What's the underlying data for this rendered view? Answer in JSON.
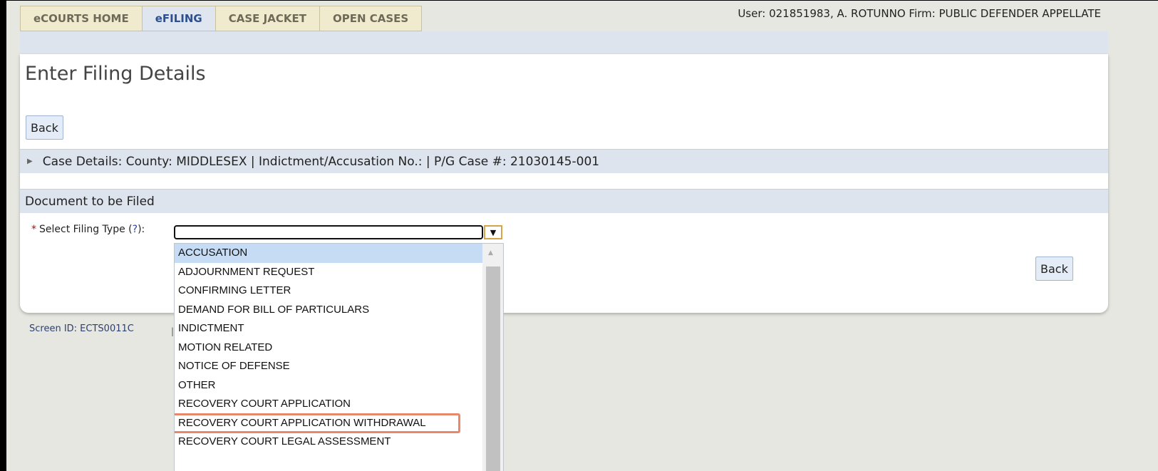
{
  "tabs": [
    {
      "label": "eCOURTS HOME",
      "active": false
    },
    {
      "label": "eFILING",
      "active": true
    },
    {
      "label": "CASE JACKET",
      "active": false
    },
    {
      "label": "OPEN CASES",
      "active": false
    }
  ],
  "header": {
    "user_info": "User: 021851983, A. ROTUNNO  Firm: PUBLIC DEFENDER APPELLATE"
  },
  "page": {
    "title": "Enter Filing Details",
    "back_label": "Back",
    "back_label_bottom": "Back"
  },
  "case_details": {
    "text": "Case Details: County: MIDDLESEX | Indictment/Accusation No.:  | P/G Case #: 21030145-001"
  },
  "document_section": {
    "title": "Document to be Filed",
    "required_marker": "*",
    "field_label": "Select Filing Type (",
    "help_link": "?",
    "field_label_end": "):",
    "selected_value": ""
  },
  "dropdown": {
    "options": [
      "ACCUSATION",
      "ADJOURNMENT REQUEST",
      "CONFIRMING LETTER",
      "DEMAND FOR BILL OF PARTICULARS",
      "INDICTMENT",
      "MOTION RELATED",
      "NOTICE OF DEFENSE",
      "OTHER",
      "RECOVERY COURT APPLICATION",
      "RECOVERY COURT APPLICATION WITHDRAWAL",
      "RECOVERY COURT LEGAL ASSESSMENT"
    ],
    "selected_index": 0,
    "highlighted_index": 9
  },
  "footer": {
    "screen_id": "Screen ID: ECTS0011C",
    "separator": "|"
  },
  "colors": {
    "tab_bg": "#f0ebce",
    "tab_active_text": "#2c4f8f",
    "section_bar": "#dde4ed",
    "highlight_outline": "#e8876a",
    "selected_option": "#c6dcf4"
  }
}
